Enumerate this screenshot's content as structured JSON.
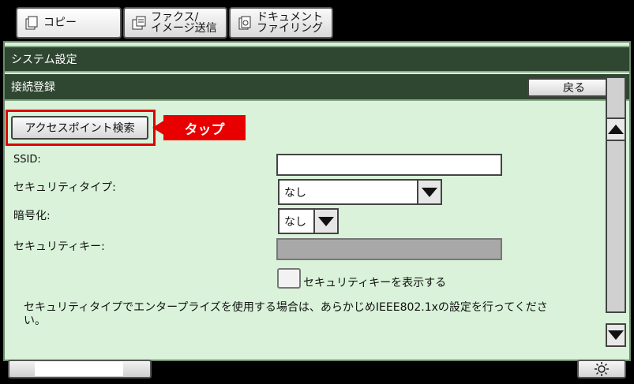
{
  "tabs": [
    {
      "label": "コピー",
      "icon": "copy-icon"
    },
    {
      "label": "ファクス/\nイメージ送信",
      "icon": "fax-icon"
    },
    {
      "label": "ドキュメント\nファイリング",
      "icon": "document-filing-icon"
    }
  ],
  "header": {
    "title": "システム設定",
    "subtitle": "接続登録",
    "back_label": "戻る"
  },
  "main": {
    "ap_search_label": "アクセスポイント検索",
    "callout_label": "タップ",
    "ssid_label": "SSID:",
    "ssid_value": "",
    "security_type_label": "セキュリティタイプ:",
    "security_type_value": "なし",
    "encryption_label": "暗号化:",
    "encryption_value": "なし",
    "security_key_label": "セキュリティキー:",
    "security_key_value": "",
    "show_key_label": "セキュリティキーを表示する",
    "show_key_checked": false,
    "note_line1": "セキュリティタイプでエンタープライズを使用する場合は、あらかじめIEEE802.1xの設定を行ってくださ",
    "note_line2": "い。"
  },
  "footer": {
    "settings_icon": "sun-icon"
  },
  "colors": {
    "header_bg": "#2f4630",
    "panel_bg": "#d9f2d9",
    "callout": "#e80000"
  }
}
